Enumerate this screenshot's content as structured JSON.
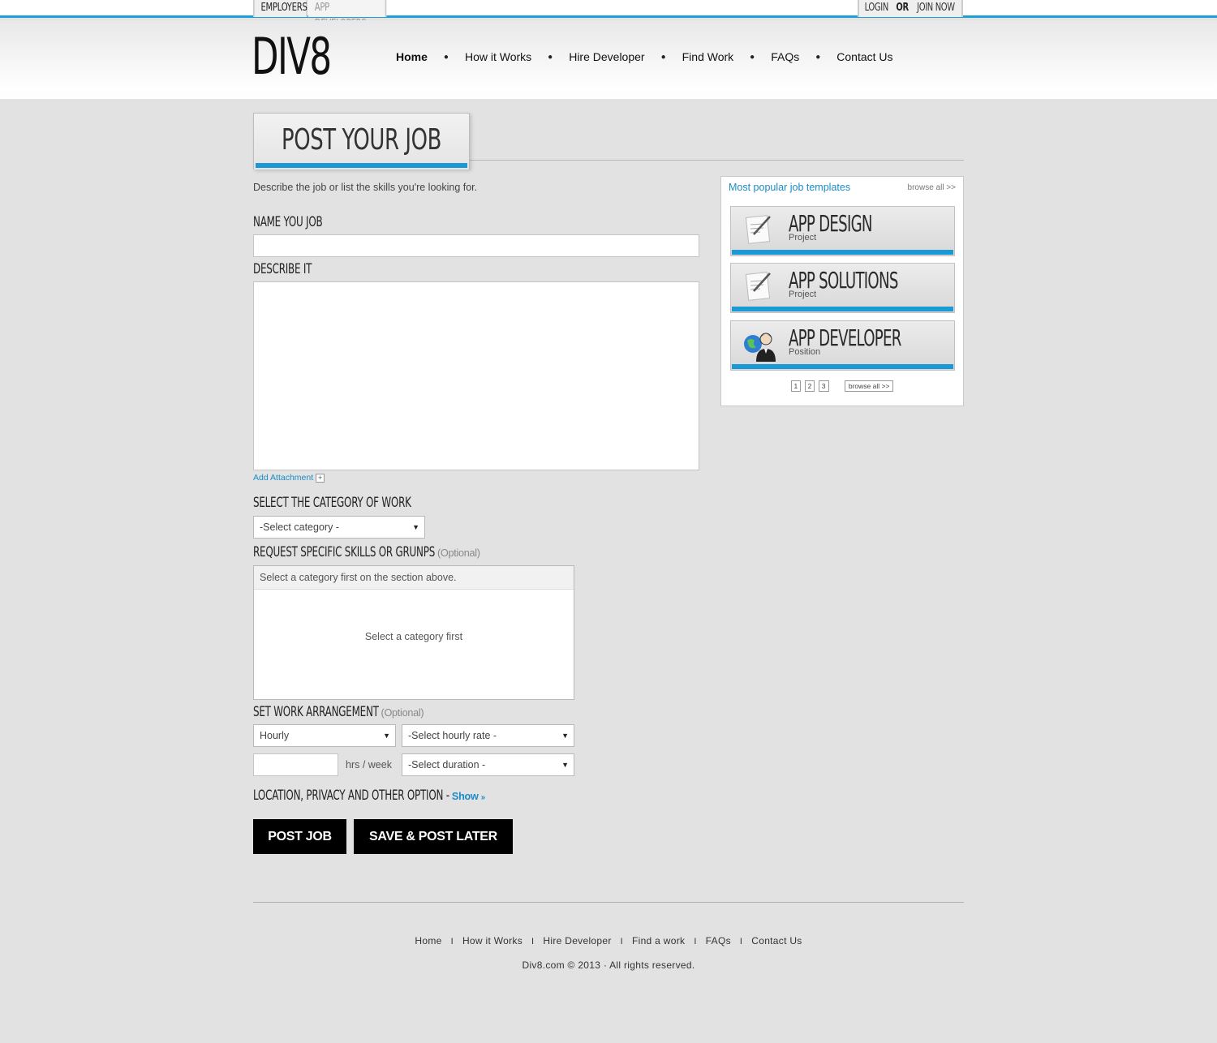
{
  "topbar": {
    "tabs": [
      {
        "label": "EMPLOYERS",
        "active": true
      },
      {
        "label": "APP DEVELOPERS",
        "active": false
      }
    ],
    "login": "LOGIN",
    "or": "OR",
    "join": "JOIN NOW"
  },
  "header": {
    "logo": "DIV8",
    "nav": [
      "Home",
      "How it Works",
      "Hire Developer",
      "Find Work",
      "FAQs",
      "Contact Us"
    ]
  },
  "page_title": "POST YOUR JOB",
  "form": {
    "intro": "Describe the job or list the skills you're looking for.",
    "name_label": "NAME YOU JOB",
    "name_value": "",
    "describe_label": "DESCRIBE IT",
    "describe_value": "",
    "add_attachment": "Add Attachment",
    "category_label": "SELECT THE CATEGORY OF WORK",
    "category_selected": "-Select category -",
    "skills_label": "REQUEST SPECIFIC SKILLS OR GRUNPS",
    "optional": "(Optional)",
    "skills_head": "Select a category first on the section above.",
    "skills_body": "Select a category first",
    "arrangement_label": "SET WORK ARRANGEMENT",
    "arrangement_type": "Hourly",
    "hourly_rate": "-Select hourly rate -",
    "hours_value": "",
    "hours_unit": "hrs / week",
    "duration": "-Select duration -",
    "location_label": "LOCATION, PRIVACY AND OTHER OPTION",
    "location_sep": "-",
    "show_link": "Show",
    "post_button": "POST JOB",
    "save_button": "SAVE & POST LATER"
  },
  "sidebar": {
    "title": "Most popular job templates",
    "browse_top": "browse all >>",
    "templates": [
      {
        "name": "APP DESIGN",
        "kind": "Project",
        "icon": "document-pen-icon"
      },
      {
        "name": "APP SOLUTIONS",
        "kind": "Project",
        "icon": "document-pen-icon"
      },
      {
        "name": "APP DEVELOPER",
        "kind": "Position",
        "icon": "globe-person-icon"
      }
    ],
    "pages": [
      "1",
      "2",
      "3"
    ],
    "browse_bottom": "browse all >>"
  },
  "footer": {
    "nav": [
      "Home",
      "How it Works",
      "Hire Developer",
      "Find a work",
      "FAQs",
      "Contact Us"
    ],
    "separator": "I",
    "copyright": "Div8.com © 2013 · All rights reserved."
  },
  "colors": {
    "accent": "#1a99d4",
    "link": "#1a8cc7",
    "background": "#e2e2e2",
    "button": "#000000"
  }
}
